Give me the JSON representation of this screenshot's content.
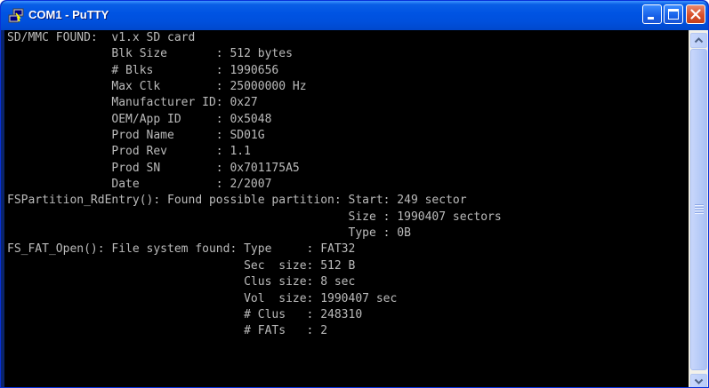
{
  "window": {
    "title": "COM1 - PuTTY"
  },
  "icons": {
    "app": "putty-icon",
    "minimize": "minimize-icon",
    "maximize": "maximize-icon",
    "close": "close-icon",
    "scroll_up": "chevron-up-icon",
    "scroll_down": "chevron-down-icon"
  },
  "colors": {
    "terminal_background": "#000000",
    "terminal_text": "#bbbbbb",
    "titlebar": "#0054e3"
  },
  "terminal": {
    "lines": [
      "SD/MMC FOUND:  v1.x SD card",
      "               Blk Size       : 512 bytes",
      "               # Blks         : 1990656",
      "               Max Clk        : 25000000 Hz",
      "               Manufacturer ID: 0x27",
      "               OEM/App ID     : 0x5048",
      "               Prod Name      : SD01G",
      "               Prod Rev       : 1.1",
      "               Prod SN        : 0x701175A5",
      "               Date           : 2/2007",
      "FSPartition_RdEntry(): Found possible partition: Start: 249 sector",
      "                                                 Size : 1990407 sectors",
      "                                                 Type : 0B",
      "FS_FAT_Open(): File system found: Type     : FAT32",
      "                                  Sec  size: 512 B",
      "                                  Clus size: 8 sec",
      "                                  Vol  size: 1990407 sec",
      "                                  # Clus   : 248310",
      "                                  # FATs   : 2"
    ]
  }
}
